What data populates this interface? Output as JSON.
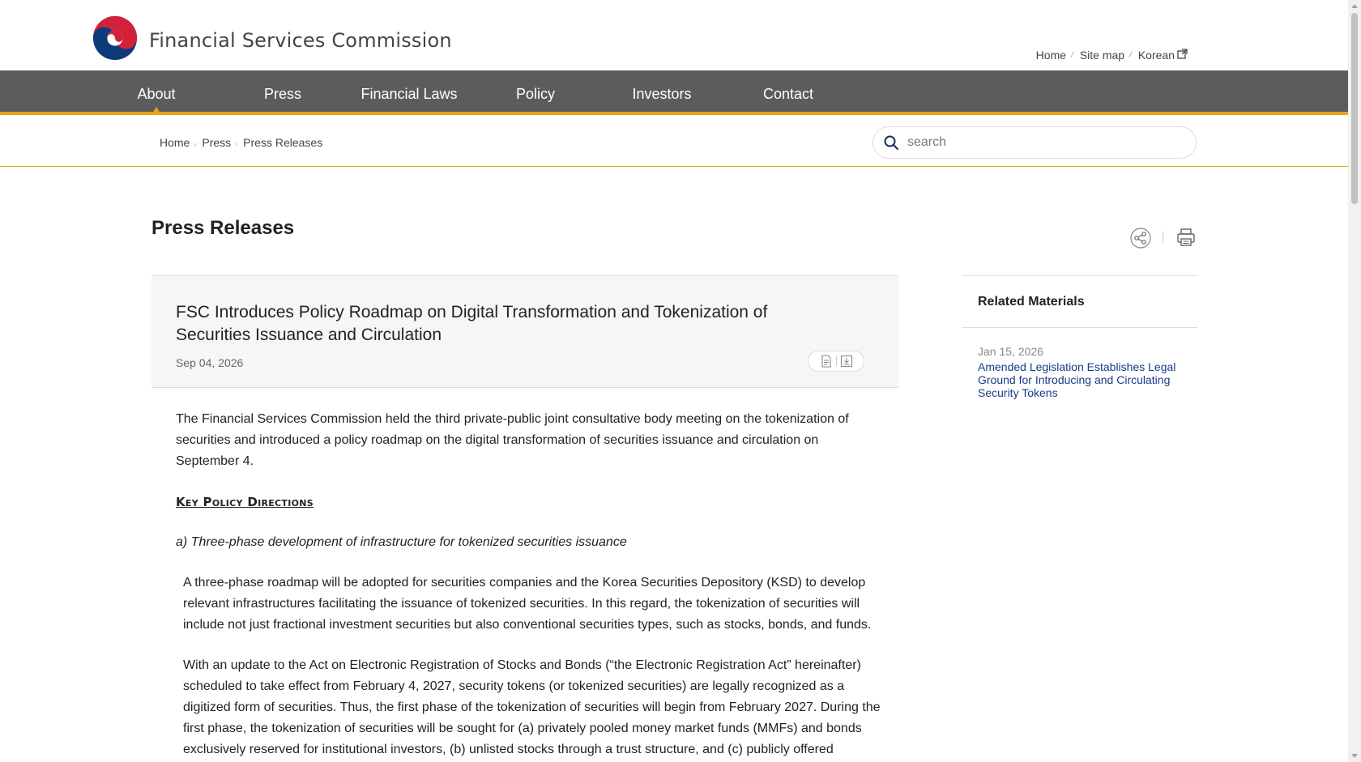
{
  "header": {
    "site_title": "Financial Services Commission",
    "util_nav": {
      "home": "Home",
      "sitemap": "Site map",
      "korean": "Korean"
    }
  },
  "gnb": {
    "items": [
      {
        "label": "About"
      },
      {
        "label": "Press"
      },
      {
        "label": "Financial Laws"
      },
      {
        "label": "Policy"
      },
      {
        "label": "Investors"
      },
      {
        "label": "Contact"
      }
    ],
    "active_index": 0
  },
  "breadcrumb": {
    "home": "Home",
    "section": "Press",
    "current": "Press Releases"
  },
  "search": {
    "placeholder": "search"
  },
  "page": {
    "title": "Press Releases"
  },
  "article": {
    "title": "FSC Introduces Policy Roadmap on Digital Transformation and Tokenization of Securities Issuance and Circulation",
    "date": "Sep 04, 2026",
    "intro": "The Financial Services Commission held the third private-public joint consultative body meeting on the tokenization of securities and introduced a policy roadmap on the digital transformation of securities issuance and circulation on September 4.",
    "key_heading": "Key Policy Directions",
    "sub_heading_a": "a) Three-phase development of infrastructure for tokenized securities issuance",
    "para_1": "A three-phase roadmap will be adopted for securities companies and the Korea Securities Depository (KSD) to develop relevant infrastructures facilitating the issuance of tokenized securities. In this regard, the tokenization of securities will include not just fractional investment securities but also conventional securities types, such as stocks, bonds, and funds.",
    "para_2": "With an update to the Act on Electronic Registration of Stocks and Bonds (“the Electronic Registration Act” hereinafter) scheduled to take effect from February 4, 2027, security tokens (or tokenized securities) are legally recognized as a digitized form of securities. Thus, the first phase of the tokenization of securities will begin from February 2027. During the first phase, the tokenization of securities will be sought for (a) privately pooled money market funds (MMFs) and bonds exclusively reserved for institutional investors, (b) unlisted stocks through a trust structure, and (c) publicly offered"
  },
  "related": {
    "title": "Related Materials",
    "items": [
      {
        "date": "Jan 15, 2026",
        "title": "Amended Legislation Establishes Legal Ground for Introducing and Circulating Security Tokens"
      }
    ]
  },
  "colors": {
    "gnb_bg": "#5c5c5c",
    "accent": "#e8a317",
    "link": "#1a3a8a"
  }
}
